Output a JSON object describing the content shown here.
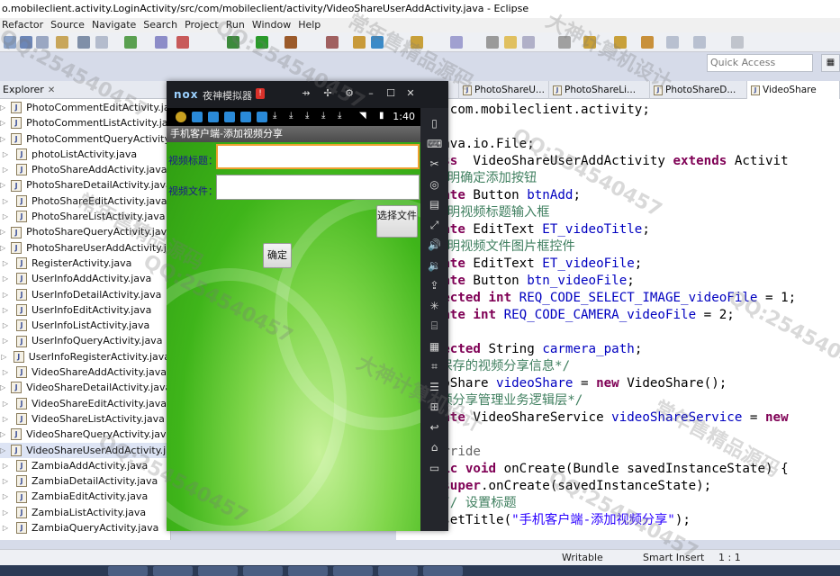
{
  "window": {
    "title": "o.mobileclient.activity.LoginActivity/src/com/mobileclient/activity/VideoShareUserAddActivity.java - Eclipse"
  },
  "menu": [
    "Refactor",
    "Source",
    "Navigate",
    "Search",
    "Project",
    "Run",
    "Window",
    "Help"
  ],
  "quick_access": {
    "placeholder": "Quick Access"
  },
  "explorer": {
    "tab_label": "Explorer",
    "close_glyph": "✕",
    "files": [
      "PhotoCommentEditActivity.java",
      "PhotoCommentListActivity.java",
      "PhotoCommentQueryActivity.java",
      "photoListActivity.java",
      "PhotoShareAddActivity.java",
      "PhotoShareDetailActivity.java",
      "PhotoShareEditActivity.java",
      "PhotoShareListActivity.java",
      "PhotoShareQueryActivity.java",
      "PhotoShareUserAddActivity.java",
      "RegisterActivity.java",
      "UserInfoAddActivity.java",
      "UserInfoDetailActivity.java",
      "UserInfoEditActivity.java",
      "UserInfoListActivity.java",
      "UserInfoQueryActivity.java",
      "UserInfoRegisterActivity.java",
      "VideoShareAddActivity.java",
      "VideoShareDetailActivity.java",
      "VideoShareEditActivity.java",
      "VideoShareListActivity.java",
      "VideoShareQueryActivity.java",
      "VideoShareUserAddActivity.java",
      "ZambiaAddActivity.java",
      "ZambiaDetailActivity.java",
      "ZambiaEditActivity.java",
      "ZambiaListActivity.java",
      "ZambiaQueryActivity.java"
    ],
    "selected_index": 22
  },
  "editor_tabs": [
    "ollecti...",
    "PhotoShareU...",
    "PhotoShareLi...",
    "PhotoShareD...",
    "VideoShare"
  ],
  "code_lines": [
    [
      [
        "kw",
        "ckage"
      ],
      [
        "",
        "  com.mobileclient.activity;"
      ]
    ],
    [],
    [
      [
        "kw",
        "ort"
      ],
      [
        "",
        "  java.io.File;"
      ]
    ],
    [
      [
        "kw",
        "ic class"
      ],
      [
        "",
        "  VideoShareUserAddActivity "
      ],
      [
        "kw",
        "extends"
      ],
      [
        "",
        " Activit"
      ]
    ],
    [
      [
        "cm",
        "  // 声明确定添加按钮"
      ]
    ],
    [
      [
        "kw",
        "  private"
      ],
      [
        "",
        " Button "
      ],
      [
        "fd",
        "btnAdd"
      ],
      [
        "",
        ";"
      ]
    ],
    [
      [
        "cm",
        "  // 声明视频标题输入框"
      ]
    ],
    [
      [
        "kw",
        "  private"
      ],
      [
        "",
        " EditText "
      ],
      [
        "fd",
        "ET_videoTitle"
      ],
      [
        "",
        ";"
      ]
    ],
    [
      [
        "cm",
        "  // 声明视频文件图片框控件"
      ]
    ],
    [
      [
        "kw",
        "  private"
      ],
      [
        "",
        " EditText "
      ],
      [
        "fd",
        "ET_videoFile"
      ],
      [
        "",
        ";"
      ]
    ],
    [
      [
        "kw",
        "  private"
      ],
      [
        "",
        " Button "
      ],
      [
        "fd",
        "btn_videoFile"
      ],
      [
        "",
        ";"
      ]
    ],
    [
      [
        "kw",
        "  protected int"
      ],
      [
        "",
        " "
      ],
      [
        "fd",
        "REQ_CODE_SELECT_IMAGE_videoFile"
      ],
      [
        "",
        " = 1;"
      ]
    ],
    [
      [
        "kw",
        "  private int"
      ],
      [
        "",
        " "
      ],
      [
        "fd",
        "REQ_CODE_CAMERA_videoFile"
      ],
      [
        "",
        " = 2;"
      ]
    ],
    [],
    [
      [
        "kw",
        "  protected"
      ],
      [
        "",
        " String "
      ],
      [
        "fd",
        "carmera_path"
      ],
      [
        "",
        ";"
      ]
    ],
    [
      [
        "cm",
        "  /*要保存的视频分享信息*/"
      ]
    ],
    [
      [
        "",
        "  VideoShare "
      ],
      [
        "fd",
        "videoShare"
      ],
      [
        "",
        " = "
      ],
      [
        "kw",
        "new"
      ],
      [
        "",
        " VideoShare();"
      ]
    ],
    [
      [
        "cm",
        "  /*视频分享管理业务逻辑层*/"
      ]
    ],
    [
      [
        "kw",
        "  private"
      ],
      [
        "",
        " VideoShareService "
      ],
      [
        "fd",
        "videoShareService"
      ],
      [
        "",
        " = "
      ],
      [
        "kw",
        "new"
      ]
    ],
    [],
    [
      [
        "an",
        "  @Override"
      ]
    ],
    [
      [
        "kw",
        "  public void"
      ],
      [
        "",
        " onCreate(Bundle savedInstanceState) {"
      ]
    ],
    [
      [
        "kw",
        "      super"
      ],
      [
        "",
        ".onCreate(savedInstanceState);"
      ]
    ],
    [
      [
        "cm",
        "      // 设置标题"
      ]
    ],
    [
      [
        "",
        "      setTitle("
      ],
      [
        "st",
        "\"手机客户端-添加视频分享\""
      ],
      [
        "",
        ");"
      ]
    ]
  ],
  "emulator": {
    "logo": "nox",
    "name": "夜神模拟器",
    "badge": "!",
    "controls": [
      "⇸",
      "✢",
      "⚙",
      "–",
      "☐",
      "✕"
    ],
    "status_time": "1:40",
    "app_title": "手机客户端-添加视频分享",
    "video_title_label": "视频标题：",
    "video_file_label": "视频文件：",
    "select_file_button": "选择文件",
    "confirm_button": "确定",
    "side_icons": [
      "▯",
      "⌨",
      "✂",
      "◎",
      "▤",
      "⤢",
      "🔊",
      "🔉",
      "⇪",
      "✳",
      "⌸",
      "▦",
      "⌗",
      "☰",
      "⊞",
      "↩",
      "⌂",
      "▭"
    ]
  },
  "status": {
    "writable": "Writable",
    "insert_mode": "Smart Insert",
    "position": "1 : 1"
  },
  "watermarks": [
    "QQ:254540457",
    "常年售精品源码",
    "大神计算机设计"
  ]
}
